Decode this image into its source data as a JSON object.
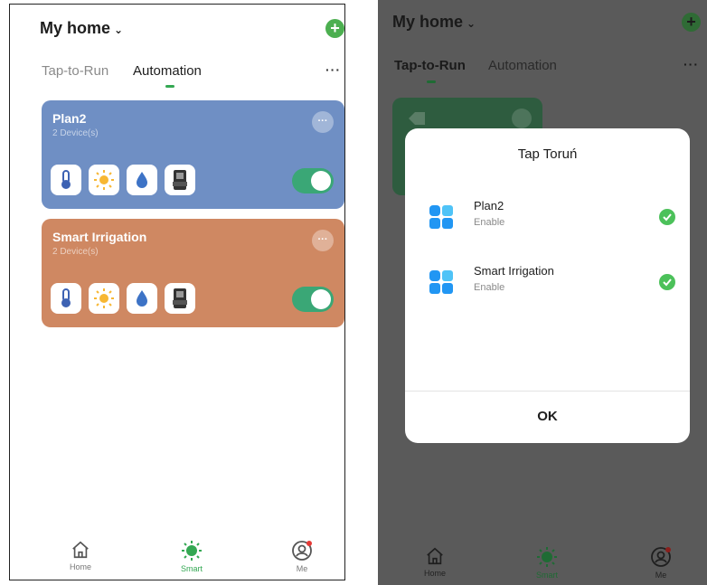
{
  "left": {
    "home_title": "My home",
    "tabs": [
      {
        "label": "Tap-to-Run",
        "active": false
      },
      {
        "label": "Automation",
        "active": true
      }
    ],
    "cards": [
      {
        "name": "Plan2",
        "subtitle": "2 Device(s)",
        "color": "#6f8fc4",
        "enabled": true
      },
      {
        "name": "Smart Irrigation",
        "subtitle": "2 Device(s)",
        "color": "#cf8862",
        "enabled": true
      }
    ],
    "nav": [
      {
        "label": "Home",
        "icon": "home-icon",
        "active": false
      },
      {
        "label": "Smart",
        "icon": "smart-sun-icon",
        "active": true
      },
      {
        "label": "Me",
        "icon": "me-icon",
        "active": false
      }
    ]
  },
  "right": {
    "home_title": "My home",
    "tabs": [
      {
        "label": "Tap-to-Run",
        "active": true
      },
      {
        "label": "Automation",
        "active": false
      }
    ],
    "dialog": {
      "title": "Tap Toruń",
      "items": [
        {
          "name": "Plan2",
          "status": "Enable"
        },
        {
          "name": "Smart Irrigation",
          "status": "Enable"
        }
      ],
      "ok_label": "OK"
    },
    "nav": [
      {
        "label": "Home",
        "icon": "home-icon"
      },
      {
        "label": "Smart",
        "icon": "smart-sun-icon"
      },
      {
        "label": "Me",
        "icon": "me-icon"
      }
    ]
  },
  "colors": {
    "accent_green": "#34a853",
    "toggle_on": "#3aa776",
    "dim_overlay": "#5a5a5a"
  }
}
